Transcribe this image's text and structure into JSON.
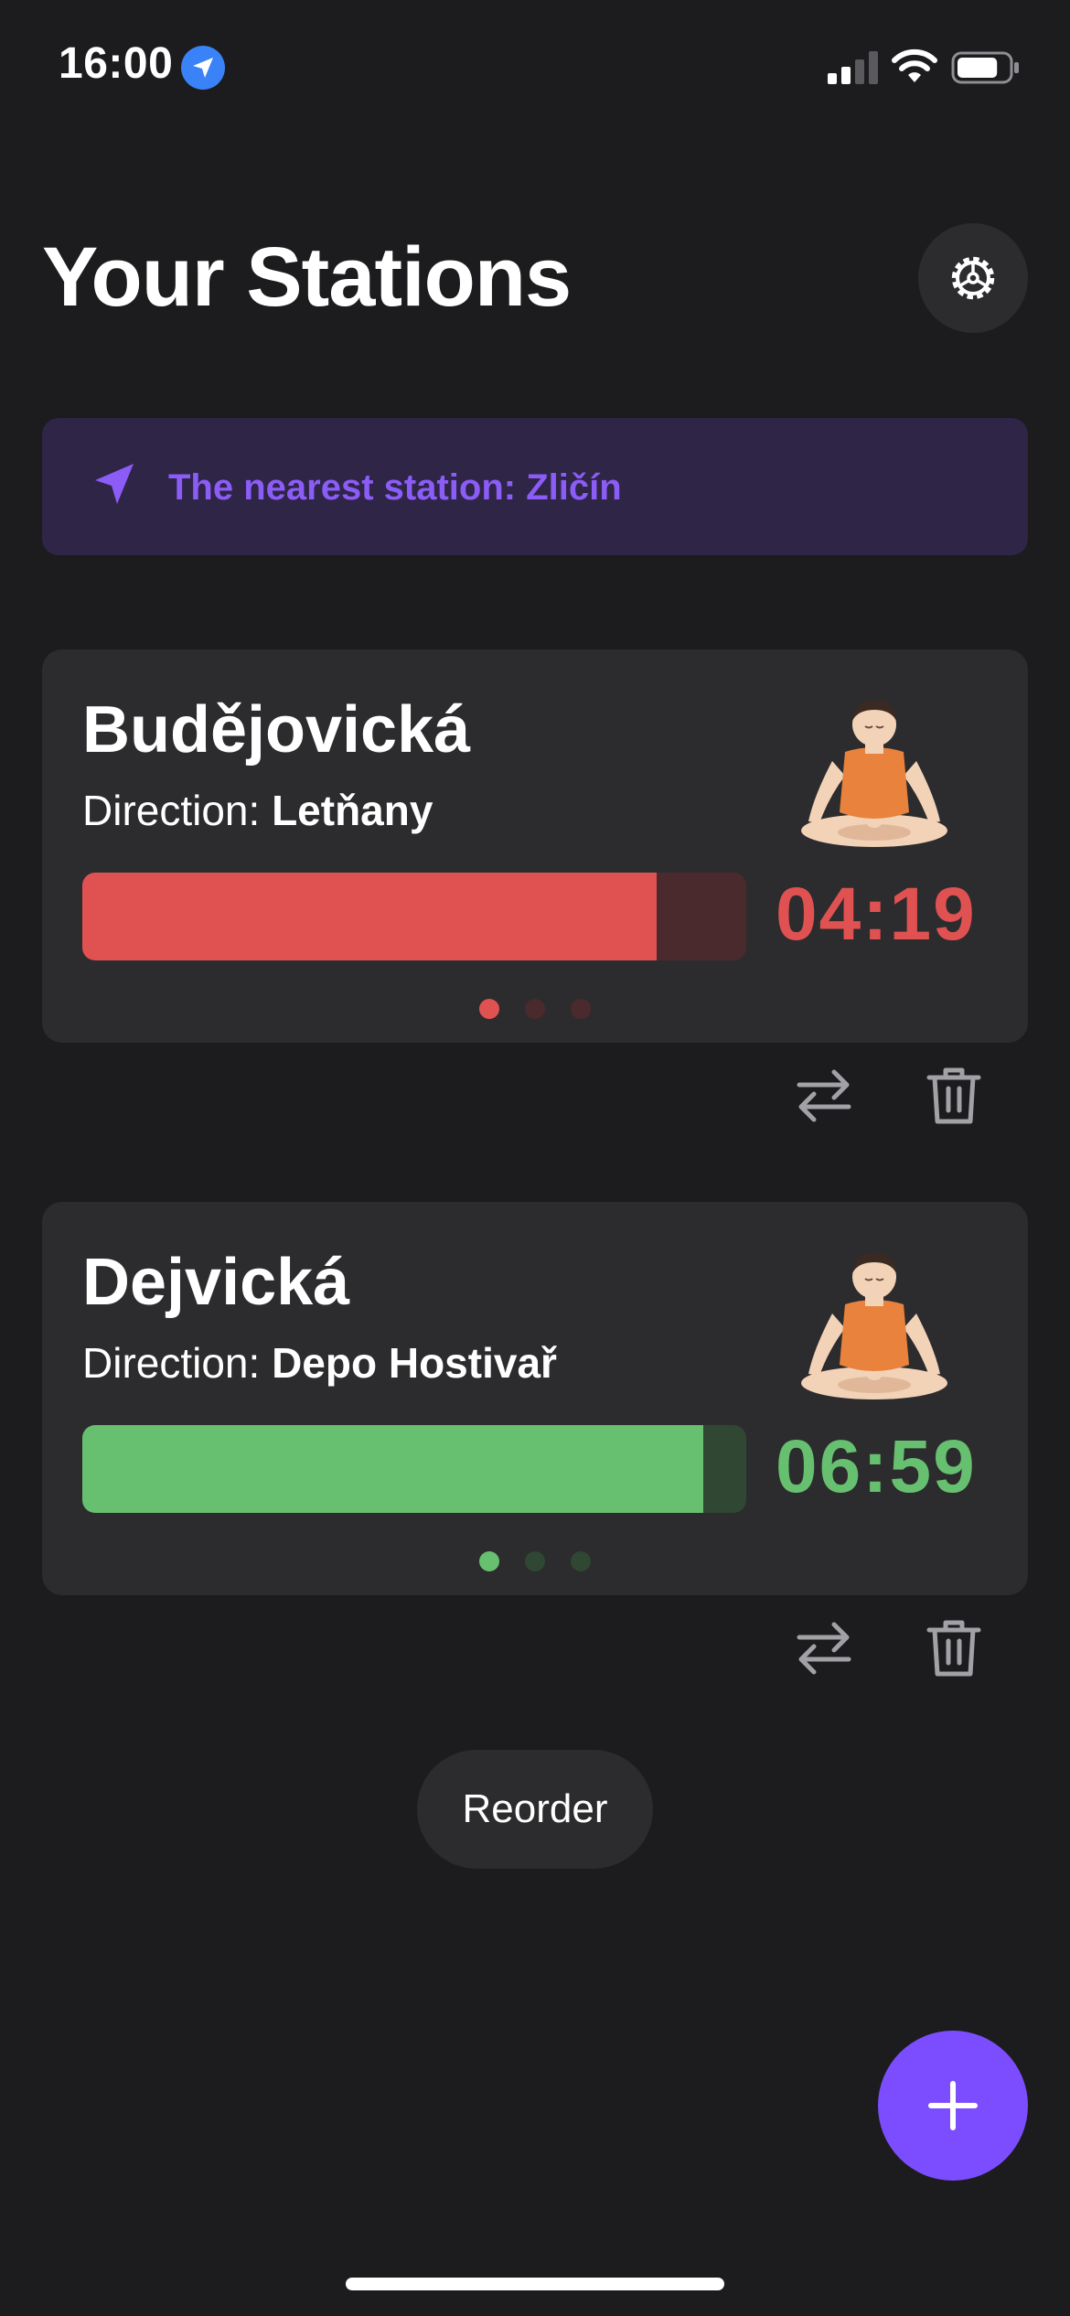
{
  "status_bar": {
    "time": "16:00",
    "signal_bars": 2,
    "battery_level": 0.8
  },
  "header": {
    "title": "Your Stations",
    "settings_icon": "gear-icon"
  },
  "nearest": {
    "text": "The nearest station: Zličín",
    "icon": "navigation-arrow-icon",
    "color": "#8b5cf6"
  },
  "stations": [
    {
      "name": "Budějovická",
      "direction_label": "Direction:",
      "direction": "Letňany",
      "countdown": "04:19",
      "progress": 0.865,
      "color": "#e05252",
      "track_color": "#4a2a2d",
      "emoji": "person-in-lotus-position",
      "dots": 3,
      "active_dot": 0
    },
    {
      "name": "Dejvická",
      "direction_label": "Direction:",
      "direction": "Depo Hostivař",
      "countdown": "06:59",
      "progress": 0.935,
      "color": "#66c06f",
      "track_color": "#2f4733",
      "emoji": "person-in-lotus-position",
      "dots": 3,
      "active_dot": 0
    }
  ],
  "reorder": {
    "label": "Reorder"
  },
  "fab": {
    "icon": "plus-icon",
    "color": "#7c4dff"
  }
}
